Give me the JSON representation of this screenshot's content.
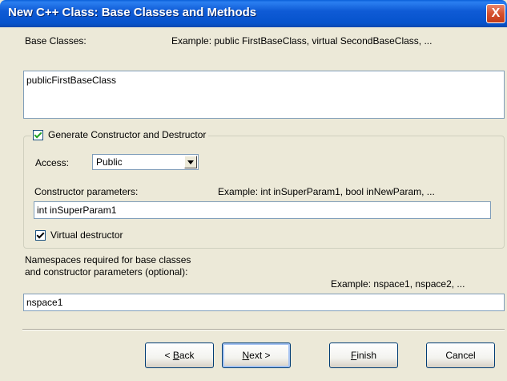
{
  "title": "New C++ Class: Base Classes and Methods",
  "close_glyph": "X",
  "base_classes": {
    "label": "Base Classes:",
    "example": "Example: public FirstBaseClass, virtual SecondBaseClass, ...",
    "value": "publicFirstBaseClass"
  },
  "ctor_group": {
    "checkbox_label": "Generate Constructor and Destructor",
    "checked": true,
    "access_label": "Access:",
    "access_value": "Public",
    "params_label": "Constructor parameters:",
    "params_example": "Example: int inSuperParam1, bool inNewParam, ...",
    "params_value": "int inSuperParam1",
    "virtual_label": "Virtual destructor",
    "virtual_checked": true
  },
  "namespaces": {
    "label_line1": "Namespaces required for base classes",
    "label_line2": "and constructor parameters (optional):",
    "example": "Example: nspace1, nspace2, ...",
    "value": "nspace1"
  },
  "buttons": {
    "back_pre": "< ",
    "back_key": "B",
    "back_post": "ack",
    "next_key": "N",
    "next_post": "ext >",
    "finish_key": "F",
    "finish_post": "inish",
    "cancel": "Cancel"
  }
}
